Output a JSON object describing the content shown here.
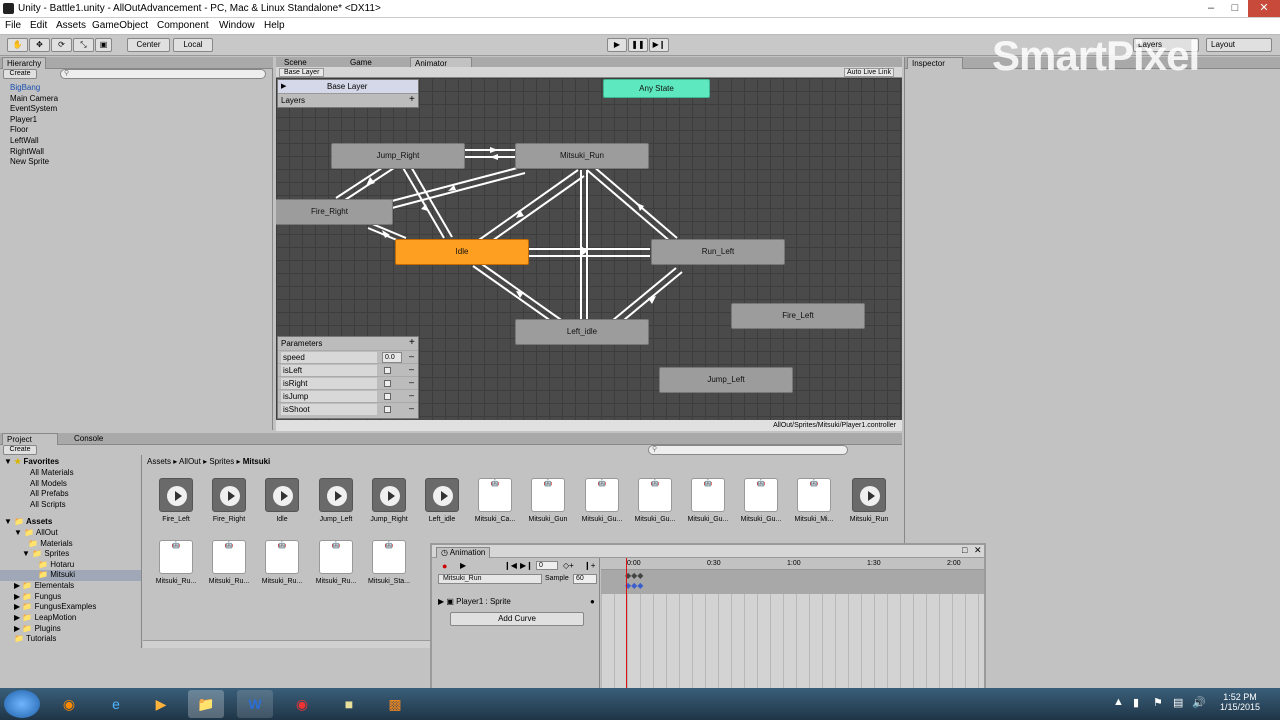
{
  "window": {
    "title": "Unity - Battle1.unity - AllOutAdvancement - PC, Mac & Linux Standalone* <DX11>"
  },
  "menu": [
    "File",
    "Edit",
    "Assets",
    "GameObject",
    "Component",
    "Window",
    "Help"
  ],
  "toolbar": {
    "center": "Center",
    "local": "Local",
    "layers": "Layers",
    "layout": "Layout"
  },
  "hierarchy": {
    "tab": "Hierarchy",
    "create": "Create",
    "items": [
      "BigBang",
      "Main Camera",
      "EventSystem",
      "Player1",
      "Floor",
      "LeftWall",
      "RightWall",
      "New Sprite"
    ]
  },
  "tabs": {
    "scene": "Scene",
    "game": "Game",
    "animator": "Animator",
    "inspector": "Inspector",
    "project": "Project",
    "console": "Console",
    "animation": "Animation"
  },
  "animator": {
    "breadcrumb": "Base Layer",
    "auto_live_link": "Auto Live Link",
    "layer_name": "Base Layer",
    "layers_label": "Layers",
    "path": "AllOut/Sprites/Mitsuki/Player1.controller",
    "states": {
      "any": "Any State",
      "jump_right": "Jump_Right",
      "mitsuki_run": "Mitsuki_Run",
      "fire_right": "Fire_Right",
      "idle": "Idle",
      "run_left": "Run_Left",
      "left_idle": "Left_idle",
      "fire_left": "Fire_Left",
      "jump_left": "Jump_Left"
    },
    "parameters_label": "Parameters",
    "params": [
      {
        "name": "speed",
        "value": "0.0"
      },
      {
        "name": "isLeft"
      },
      {
        "name": "isRight"
      },
      {
        "name": "isJump"
      },
      {
        "name": "isShoot"
      }
    ]
  },
  "project": {
    "create": "Create",
    "breadcrumb": [
      "Assets",
      "AllOut",
      "Sprites",
      "Mitsuki"
    ],
    "favorites": {
      "label": "Favorites",
      "items": [
        "All Materials",
        "All Models",
        "All Prefabs",
        "All Scripts"
      ]
    },
    "assets": {
      "label": "Assets",
      "items": [
        "AllOut",
        "Materials",
        "Sprites",
        "Hotaru",
        "Mitsuki",
        "Elementals",
        "Fungus",
        "FungusExamples",
        "LeapMotion",
        "Plugins",
        "Tutorials"
      ]
    },
    "row1": [
      "Fire_Left",
      "Fire_Right",
      "Idle",
      "Jump_Left",
      "Jump_Right",
      "Left_idle",
      "Mitsuki_Ca...",
      "Mitsuki_Gun",
      "Mitsuki_Gu...",
      "Mitsuki_Gu...",
      "Mitsuki_Gu...",
      "Mitsuki_Gu...",
      "Mitsuki_Mi...",
      "Mitsuki_Run"
    ],
    "row2": [
      "Mitsuki_Ru...",
      "Mitsuki_Ru...",
      "Mitsuki_Ru...",
      "Mitsuki_Ru...",
      "Mitsuki_Sta..."
    ]
  },
  "animation": {
    "frame": "0",
    "clip": "Mitsuki_Run",
    "sample_label": "Sample",
    "sample": "60",
    "property": "Player1 : Sprite",
    "add_curve": "Add Curve",
    "ticks": [
      "0:00",
      "0:30",
      "1:00",
      "1:30",
      "2:00"
    ]
  },
  "watermark": "SmartPixel",
  "taskbar": {
    "time": "1:52 PM",
    "date": "1/15/2015"
  }
}
